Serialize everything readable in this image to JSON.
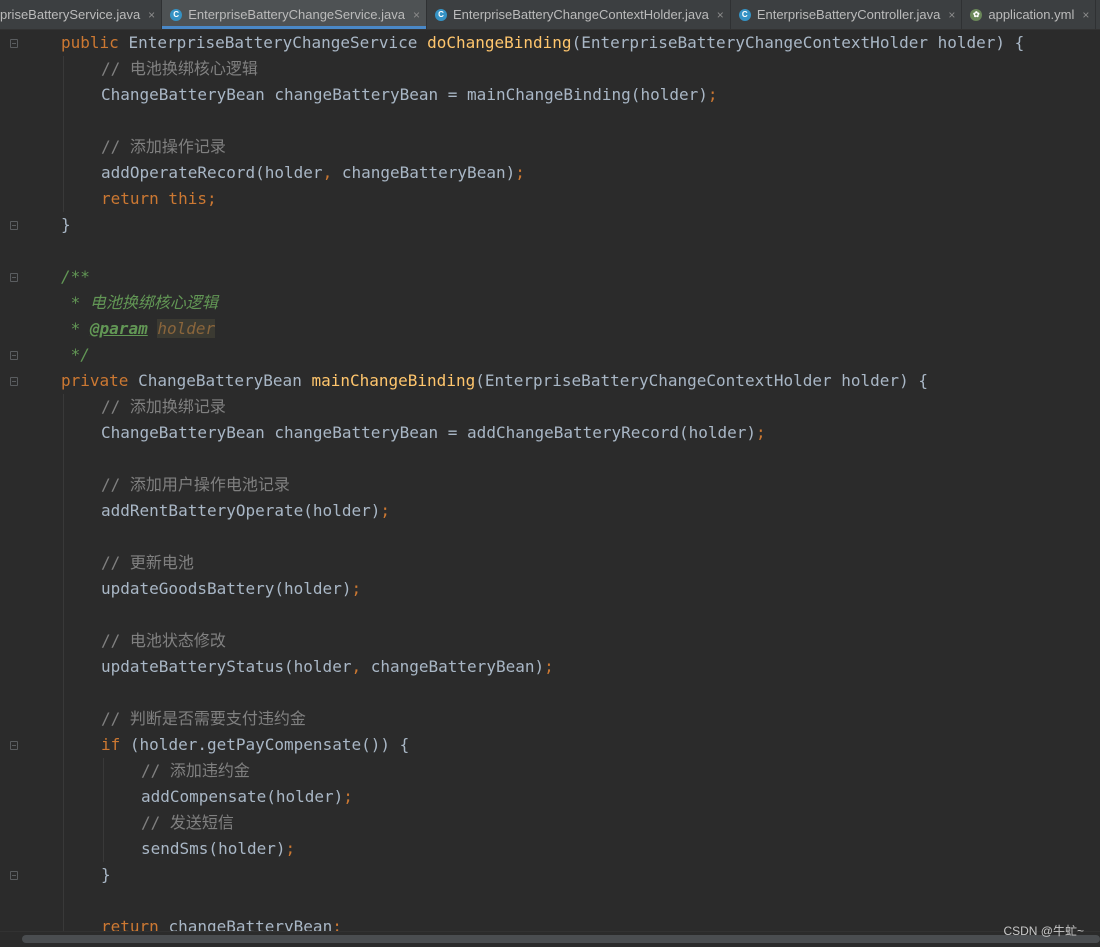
{
  "tabs": [
    {
      "label": "priseBatteryService.java",
      "icon": "class-icon",
      "active": false
    },
    {
      "label": "EnterpriseBatteryChangeService.java",
      "icon": "class-icon",
      "active": true
    },
    {
      "label": "EnterpriseBatteryChangeContextHolder.java",
      "icon": "class-icon",
      "active": false
    },
    {
      "label": "EnterpriseBatteryController.java",
      "icon": "class-icon",
      "active": false
    },
    {
      "label": "application.yml",
      "icon": "spring-yml-icon",
      "active": false
    }
  ],
  "close_glyph": "×",
  "code": {
    "l1": {
      "kw1": "public ",
      "t1": "EnterpriseBatteryChangeService ",
      "fn": "doChangeBinding",
      "t2": "(EnterpriseBatteryChangeContextHolder holder) {"
    },
    "l2": {
      "cm": "// 电池换绑核心逻辑"
    },
    "l3": {
      "t1": "ChangeBatteryBean changeBatteryBean = mainChangeBinding(holder)",
      "sc": ";"
    },
    "l5": {
      "cm": "// 添加操作记录"
    },
    "l6": {
      "t1": "addOperateRecord(holder",
      "sc1": ", ",
      "t2": "changeBatteryBean)",
      "sc2": ";"
    },
    "l7": {
      "kw1": "return this",
      "sc": ";"
    },
    "l8": {
      "t1": "}"
    },
    "l10": {
      "doc": "/**"
    },
    "l11": {
      "doc": " * 电池换绑核心逻辑"
    },
    "l12": {
      "doc1": " * ",
      "tag": "@param",
      "sp": " ",
      "prm": "holder"
    },
    "l13": {
      "doc": " */"
    },
    "l14": {
      "kw1": "private ",
      "t1": "ChangeBatteryBean ",
      "fn": "mainChangeBinding",
      "t2": "(EnterpriseBatteryChangeContextHolder holder) {"
    },
    "l15": {
      "cm": "// 添加换绑记录"
    },
    "l16": {
      "t1": "ChangeBatteryBean changeBatteryBean = addChangeBatteryRecord(holder)",
      "sc": ";"
    },
    "l18": {
      "cm": "// 添加用户操作电池记录"
    },
    "l19": {
      "t1": "addRentBatteryOperate(holder)",
      "sc": ";"
    },
    "l21": {
      "cm": "// 更新电池"
    },
    "l22": {
      "t1": "updateGoodsBattery(holder)",
      "sc": ";"
    },
    "l24": {
      "cm": "// 电池状态修改"
    },
    "l25": {
      "t1": "updateBatteryStatus(holder",
      "sc1": ", ",
      "t2": "changeBatteryBean)",
      "sc2": ";"
    },
    "l27": {
      "cm": "// 判断是否需要支付违约金"
    },
    "l28": {
      "kw1": "if ",
      "t1": "(holder.getPayCompensate()) {"
    },
    "l29": {
      "cm": "// 添加违约金"
    },
    "l30": {
      "t1": "addCompensate(holder)",
      "sc": ";"
    },
    "l31": {
      "cm": "// 发送短信"
    },
    "l32": {
      "t1": "sendSms(holder)",
      "sc": ";"
    },
    "l33": {
      "t1": "}"
    },
    "l35": {
      "kw1": "return ",
      "t1": "changeBatteryBean",
      "sc": ";"
    }
  },
  "watermark": "CSDN @牛虻~",
  "colors": {
    "background": "#2b2b2b",
    "keyword": "#cc7832",
    "function": "#ffc66d",
    "text": "#a9b7c6",
    "comment": "#808080",
    "doc": "#629755",
    "tab_underline": "#4a88c7"
  }
}
